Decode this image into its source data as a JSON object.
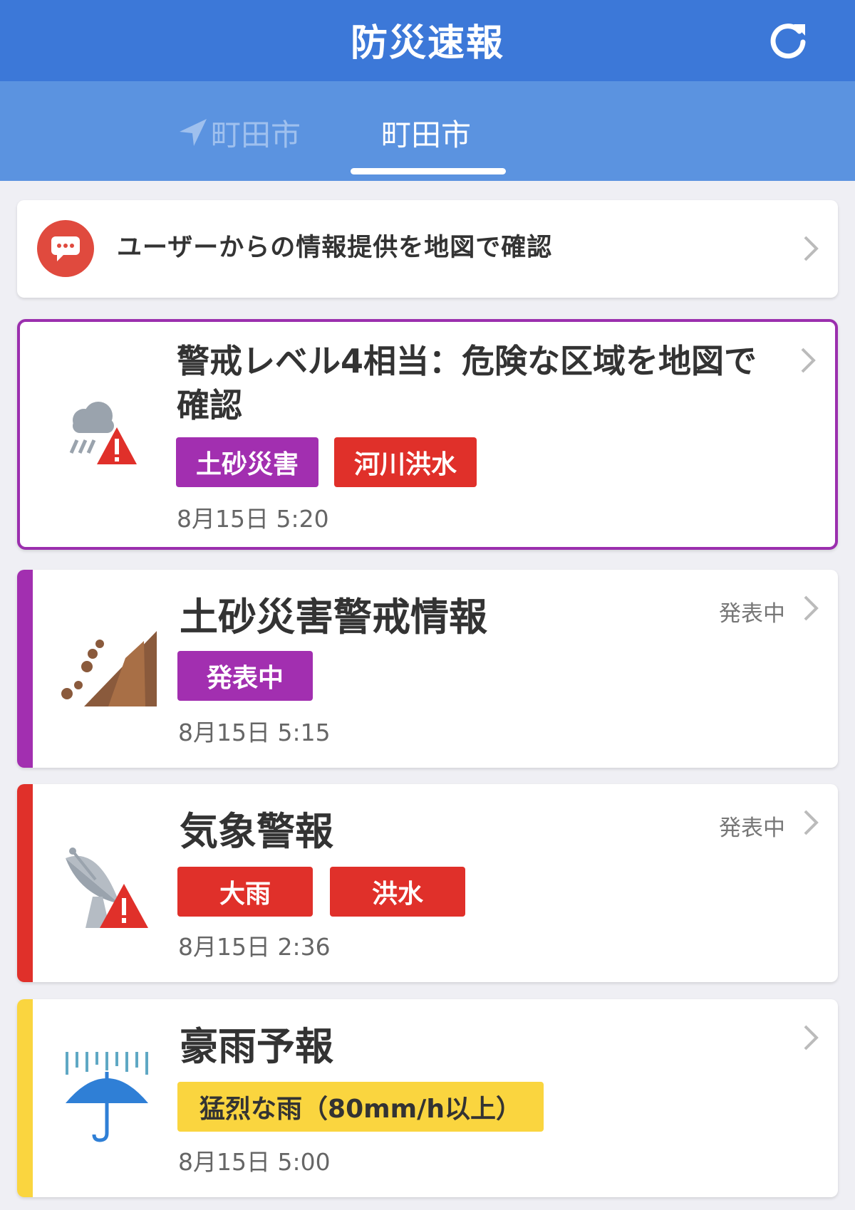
{
  "header": {
    "title": "防災速報",
    "refresh_icon": "refresh-icon",
    "background": "#3c78d8"
  },
  "tabs": [
    {
      "label": "町田市",
      "icon": "location-arrow-icon",
      "selected": false
    },
    {
      "label": "町田市",
      "selected": true
    }
  ],
  "user_report": {
    "label": "ユーザーからの情報提供を地図で確認",
    "icon": "chat-bubble-icon"
  },
  "alerts": [
    {
      "title": "警戒レベル4相当：危険な区域を地図で確認",
      "title_line1": "警戒レベル4相当：危険な区域を地図で",
      "title_line2": "確認",
      "icon": "rain-warning-icon",
      "tags": [
        {
          "label": "土砂災害",
          "color": "#a22fb0"
        },
        {
          "label": "河川洪水",
          "color": "#e0302a"
        }
      ],
      "timestamp": "8月15日 5:20",
      "border_color": "#9b2fae"
    },
    {
      "title": "土砂災害警戒情報",
      "icon": "landslide-icon",
      "status": "発表中",
      "tags": [
        {
          "label": "発表中",
          "color": "#a22fb0"
        }
      ],
      "timestamp": "8月15日 5:15",
      "accent": "#a22fb0"
    },
    {
      "title": "気象警報",
      "icon": "radar-warning-icon",
      "status": "発表中",
      "tags": [
        {
          "label": "大雨",
          "color": "#e0302a"
        },
        {
          "label": "洪水",
          "color": "#e0302a"
        }
      ],
      "timestamp": "8月15日 2:36",
      "accent": "#e0302a"
    },
    {
      "title": "豪雨予報",
      "icon": "umbrella-rain-icon",
      "tags": [
        {
          "label": "猛烈な雨（80mm/h以上）",
          "color": "#fad53f"
        }
      ],
      "timestamp": "8月15日 5:00",
      "accent": "#fad53f"
    }
  ]
}
